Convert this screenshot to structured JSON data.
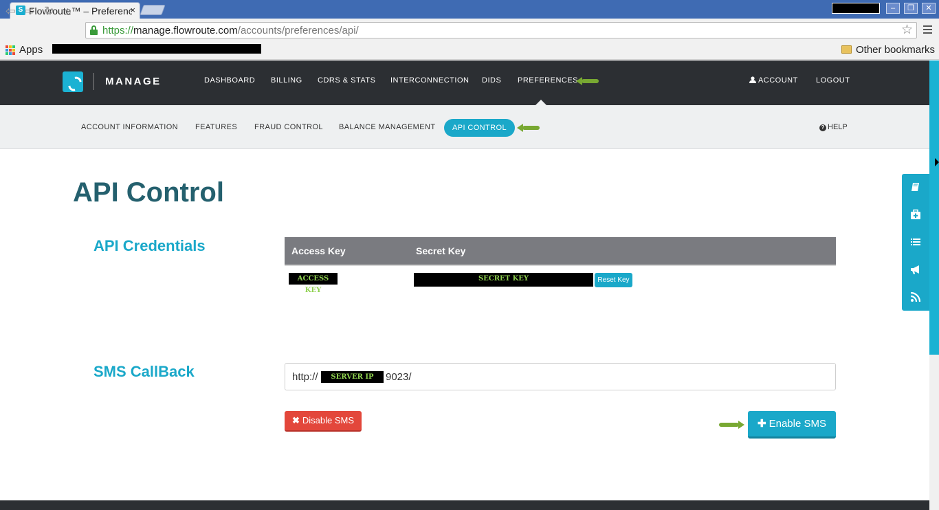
{
  "browser": {
    "tab_title": "Flowroute™ – Preferences",
    "tab_close": "×",
    "url_scheme": "https://",
    "url_host": "manage.flowroute.com",
    "url_path": "/accounts/preferences/api/",
    "bookmarks": {
      "apps_label": "Apps",
      "other_label": "Other bookmarks"
    },
    "window_buttons": [
      "–",
      "❐",
      "✕"
    ]
  },
  "header": {
    "logo_text": "MANAGE",
    "nav": [
      "DASHBOARD",
      "BILLING",
      "CDRS & STATS",
      "INTERCONNECTION",
      "DIDS",
      "PREFERENCES"
    ],
    "account_label": "ACCOUNT",
    "logout_label": "LOGOUT",
    "active": "PREFERENCES"
  },
  "subnav": {
    "items": [
      "ACCOUNT INFORMATION",
      "FEATURES",
      "FRAUD CONTROL",
      "BALANCE MANAGEMENT",
      "API CONTROL"
    ],
    "active": "API CONTROL",
    "help_label": "HELP"
  },
  "main": {
    "page_title": "API Control",
    "credentials": {
      "title": "API Credentials",
      "columns": [
        "Access Key",
        "Secret Key"
      ],
      "access_key": "ACCESS KEY",
      "secret_key": "SECRET KEY",
      "reset_label": "Reset Key"
    },
    "sms": {
      "title": "SMS CallBack",
      "url_prefix": "http://",
      "server_ip": "SERVER IP",
      "url_suffix": "9023/",
      "disable_label": "Disable SMS",
      "enable_label": "Enable SMS"
    }
  },
  "side_widget": [
    "book-icon",
    "medkit-icon",
    "list-icon",
    "megaphone-icon",
    "rss-icon"
  ],
  "colors": {
    "brand": "#1aa8c9",
    "header_bg": "#2c2f33",
    "danger": "#e3473b",
    "annotation_arrow": "#78a832"
  }
}
